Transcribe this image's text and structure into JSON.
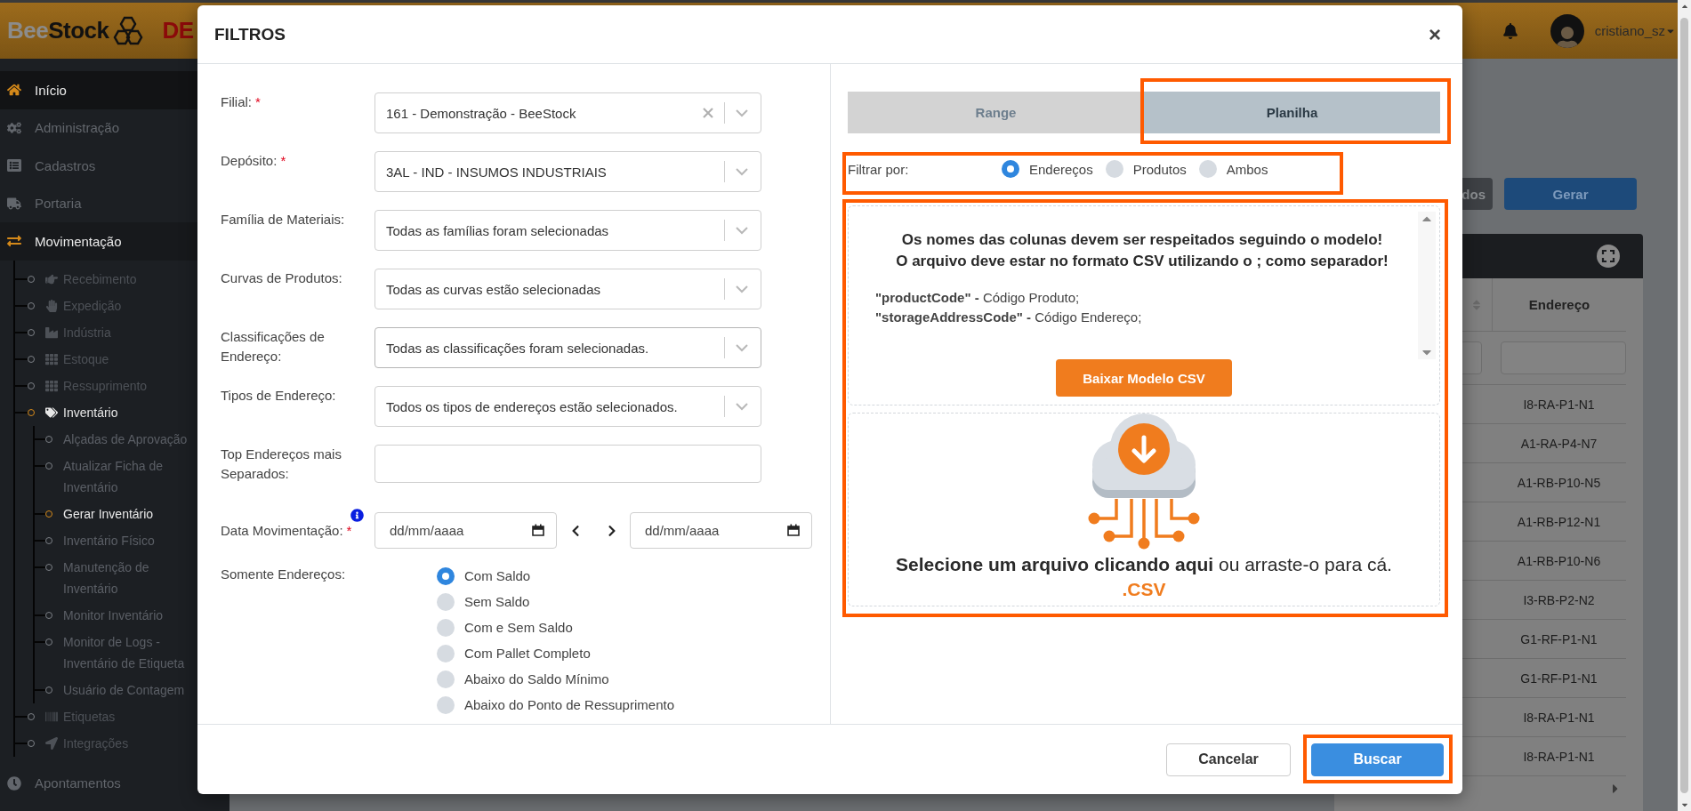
{
  "header": {
    "logo": [
      "Bee",
      "Stock"
    ],
    "environment": "DE",
    "user": "cristiano_sz"
  },
  "sidebar": {
    "items": [
      {
        "label": "Início",
        "selected": true
      },
      {
        "label": "Administração",
        "selected": false
      },
      {
        "label": "Cadastros",
        "selected": false
      },
      {
        "label": "Portaria",
        "selected": false
      },
      {
        "label": "Movimentação",
        "expanded": true,
        "children": [
          {
            "label": "Recebimento",
            "selected": false
          },
          {
            "label": "Expedição",
            "selected": false
          },
          {
            "label": "Indústria",
            "selected": false
          },
          {
            "label": "Estoque",
            "selected": false
          },
          {
            "label": "Ressuprimento",
            "selected": false
          },
          {
            "label": "Inventário",
            "selected": false,
            "expanded": true,
            "children": [
              {
                "label": "Alçadas de Aprovação",
                "selected": false
              },
              {
                "label": "Atualizar Ficha de Inventário",
                "selected": false
              },
              {
                "label": "Gerar Inventário",
                "selected": true
              },
              {
                "label": "Inventário Físico",
                "selected": false
              },
              {
                "label": "Manutenção de Inventário",
                "selected": false
              },
              {
                "label": "Monitor Inventário",
                "selected": false
              },
              {
                "label": "Monitor de Logs - Inventário de Etiqueta",
                "selected": false
              },
              {
                "label": "Usuário de Contagem",
                "selected": false
              }
            ]
          },
          {
            "label": "Etiquetas",
            "selected": false
          },
          {
            "label": "Integrações",
            "selected": false
          }
        ]
      },
      {
        "label": "Apontamentos",
        "selected": false
      }
    ]
  },
  "background": {
    "actions": [
      {
        "label": "dos",
        "kind": "dark"
      },
      {
        "label": "Gerar",
        "kind": "primary"
      }
    ],
    "table": {
      "columns": [
        "Endereço"
      ],
      "rows": [
        "I8-RA-P1-N1",
        "A1-RA-P4-N7",
        "A1-RB-P10-N5",
        "A1-RB-P12-N1",
        "A1-RB-P10-N6",
        "I3-RB-P2-N2",
        "G1-RF-P1-N1",
        "G1-RF-P1-N1",
        "I8-RA-P1-N1",
        "I8-RA-P1-N1"
      ]
    }
  },
  "dialog": {
    "title": "FILTROS",
    "close": "×",
    "fields": [
      {
        "kind": "select",
        "label": "Filial:",
        "required_mark": "*",
        "value": "161 - Demonstração - BeeStock",
        "clearable": true
      },
      {
        "kind": "select",
        "label": "Depósito:",
        "required_mark": "*",
        "value": "3AL - IND - INSUMOS INDUSTRIAIS"
      },
      {
        "kind": "select",
        "label": "Família de Materiais:",
        "value": "Todas as famílias foram selecionadas"
      },
      {
        "kind": "select",
        "label": "Curvas de Produtos:",
        "value": "Todas as curvas estão selecionadas"
      },
      {
        "kind": "select",
        "label": "Classificações de Endereço:",
        "value": "Todas as classificações foram selecionadas."
      },
      {
        "kind": "select",
        "label": "Tipos de Endereço:",
        "value": "Todos os tipos de endereços estão selecionados."
      },
      {
        "kind": "text",
        "label": "Top Endereços mais Separados:"
      },
      {
        "kind": "date_range",
        "label": "Data Movimentação:",
        "required_mark": "*",
        "info": true,
        "from_placeholder": "dd/mm/aaaa",
        "to_placeholder": "dd/mm/aaaa"
      },
      {
        "kind": "radio_group",
        "label": "Somente Endereços:",
        "options": [
          {
            "label": "Com Saldo",
            "selected": true
          },
          {
            "label": "Sem Saldo",
            "selected": false
          },
          {
            "label": "Com e Sem Saldo",
            "selected": false
          },
          {
            "label": "Com Pallet Completo",
            "selected": false
          },
          {
            "label": "Abaixo do Saldo Mínimo",
            "selected": false
          },
          {
            "label": "Abaixo do Ponto de Ressuprimento",
            "selected": false
          }
        ]
      }
    ],
    "tabs": [
      {
        "label": "Range",
        "selected": false
      },
      {
        "label": "Planilha",
        "selected": true
      }
    ],
    "filter_by": {
      "label": "Filtrar por:",
      "options": [
        {
          "label": "Endereços",
          "selected": true
        },
        {
          "label": "Produtos",
          "selected": false
        },
        {
          "label": "Ambos",
          "selected": false
        }
      ]
    },
    "instructions": {
      "lines": [
        "Os nomes das colunas devem ser respeitados seguindo o modelo!",
        "O arquivo deve estar no formato CSV utilizando o ; como separador!"
      ],
      "columns": [
        "**\"productCode\" -** Código Produto;",
        "**\"storageAddressCode\" -** Código Endereço;"
      ],
      "download_button": "Baixar Modelo CSV"
    },
    "upload": {
      "text": "**Selecione um arquivo clicando aqui** ou arraste-o para cá.",
      "extension": ".CSV"
    },
    "buttons": [
      {
        "label": "Cancelar",
        "kind": "secondary"
      },
      {
        "label": "Buscar",
        "kind": "primary"
      }
    ]
  }
}
